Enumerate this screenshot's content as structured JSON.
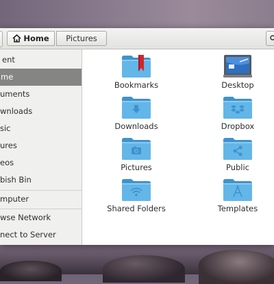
{
  "toolbar": {
    "path_home_label": "Home",
    "path_current_label": "Pictures"
  },
  "sidebar": {
    "items": [
      {
        "label": "ent"
      },
      {
        "label": "me"
      },
      {
        "label": "uments"
      },
      {
        "label": "wnloads"
      },
      {
        "label": "sic"
      },
      {
        "label": "ures"
      },
      {
        "label": "eos"
      },
      {
        "label": "bish Bin"
      }
    ],
    "devices": [
      {
        "label": "mputer"
      }
    ],
    "network": [
      {
        "label": "wse Network"
      },
      {
        "label": "nect to Server"
      }
    ]
  },
  "files": [
    {
      "name": "Bookmarks",
      "icon": "bookmark-folder-icon"
    },
    {
      "name": "Desktop",
      "icon": "desktop-folder-icon"
    },
    {
      "name": "Downloads",
      "icon": "download-folder-icon"
    },
    {
      "name": "Dropbox",
      "icon": "dropbox-folder-icon"
    },
    {
      "name": "Pictures",
      "icon": "pictures-folder-icon"
    },
    {
      "name": "Public",
      "icon": "public-folder-icon"
    },
    {
      "name": "Shared Folders",
      "icon": "shared-folder-icon"
    },
    {
      "name": "Templates",
      "icon": "templates-folder-icon"
    }
  ],
  "colors": {
    "folder": "#63b6e8",
    "folder_dark": "#3f93cc",
    "selection": "#858585"
  }
}
